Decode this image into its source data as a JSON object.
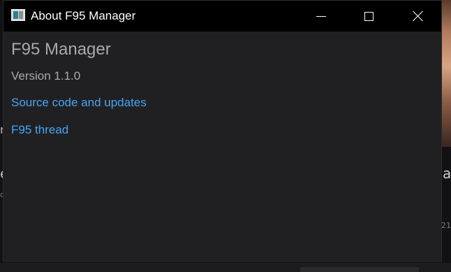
{
  "window": {
    "title": "About F95 Manager",
    "icon": "app-window-icon",
    "controls": {
      "minimize_icon": "minimize-icon",
      "maximize_icon": "maximize-icon",
      "close_icon": "close-icon"
    }
  },
  "about": {
    "app_name": "F95 Manager",
    "version": "Version 1.1.0",
    "links": {
      "source": "Source code and updates",
      "thread": "F95 thread"
    }
  },
  "background": {
    "left_fragment_1": "n",
    "left_fragment_2": "e",
    "left_fragment_3": "c",
    "right_fragment": "a",
    "right_sub_fragment": "21"
  },
  "colors": {
    "titlebar": "#000000",
    "window_bg": "#202023",
    "link": "#4aa3f0",
    "muted_text": "#a9a9a9"
  }
}
